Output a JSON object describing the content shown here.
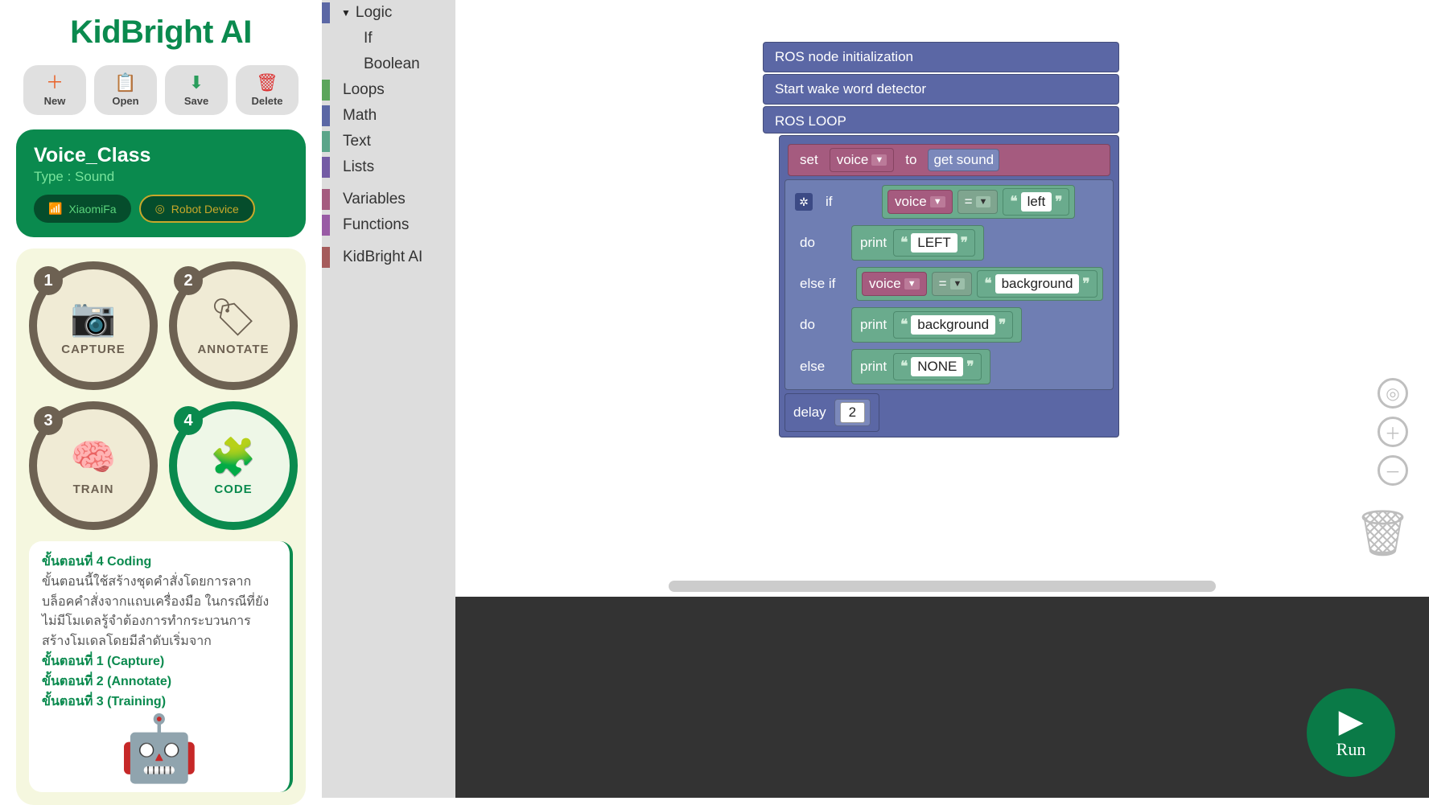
{
  "app": {
    "title": "KidBright AI"
  },
  "toolbar": {
    "new": "New",
    "open": "Open",
    "save": "Save",
    "delete": "Delete"
  },
  "project": {
    "name": "Voice_Class",
    "type_label": "Type : Sound",
    "device": "XiaomiFa",
    "robot": "Robot Device"
  },
  "steps": [
    {
      "n": "1",
      "label": "CAPTURE"
    },
    {
      "n": "2",
      "label": "ANNOTATE"
    },
    {
      "n": "3",
      "label": "TRAIN"
    },
    {
      "n": "4",
      "label": "CODE"
    }
  ],
  "instructions": {
    "h1": "ขั้นตอนที่ 4 Coding",
    "p1": "ขั้นตอนนี้ใช้สร้างชุดคำสั่งโดยการลากบล็อคคำสั่งจากแถบเครื่องมือ ในกรณีที่ยังไม่มีโมเดลรู้จำต้องการทำกระบวนการสร้างโมเดลโดยมีลำดับเริ่มจาก",
    "l1": "ขั้นตอนที่ 1 (Capture)",
    "l2": "ขั้นตอนที่ 2 (Annotate)",
    "l3": "ขั้นตอนที่ 3 (Training)"
  },
  "categories": {
    "logic": "Logic",
    "logic_if": "If",
    "logic_bool": "Boolean",
    "loops": "Loops",
    "math": "Math",
    "text": "Text",
    "lists": "Lists",
    "variables": "Variables",
    "functions": "Functions",
    "kidbright": "KidBright AI"
  },
  "colors": {
    "logic": "#5b67a5",
    "loops": "#5ba55b",
    "math": "#5b67a5",
    "text": "#5ba58a",
    "lists": "#745ba5",
    "variables": "#a55b7f",
    "functions": "#995ba5",
    "kidbright": "#a55b5b"
  },
  "blocks": {
    "ros_init": "ROS node initialization",
    "wake": "Start wake word detector",
    "loop": "ROS LOOP",
    "set": "set",
    "to": "to",
    "var_voice": "voice",
    "getsound": "get sound",
    "if": "if",
    "do": "do",
    "elseif": "else if",
    "else": "else",
    "eq": "=",
    "left": "left",
    "background": "background",
    "print": "print",
    "LEFT": "LEFT",
    "bg2": "background",
    "NONE": "NONE",
    "delay": "delay",
    "delay_v": "2"
  },
  "run": "Run"
}
